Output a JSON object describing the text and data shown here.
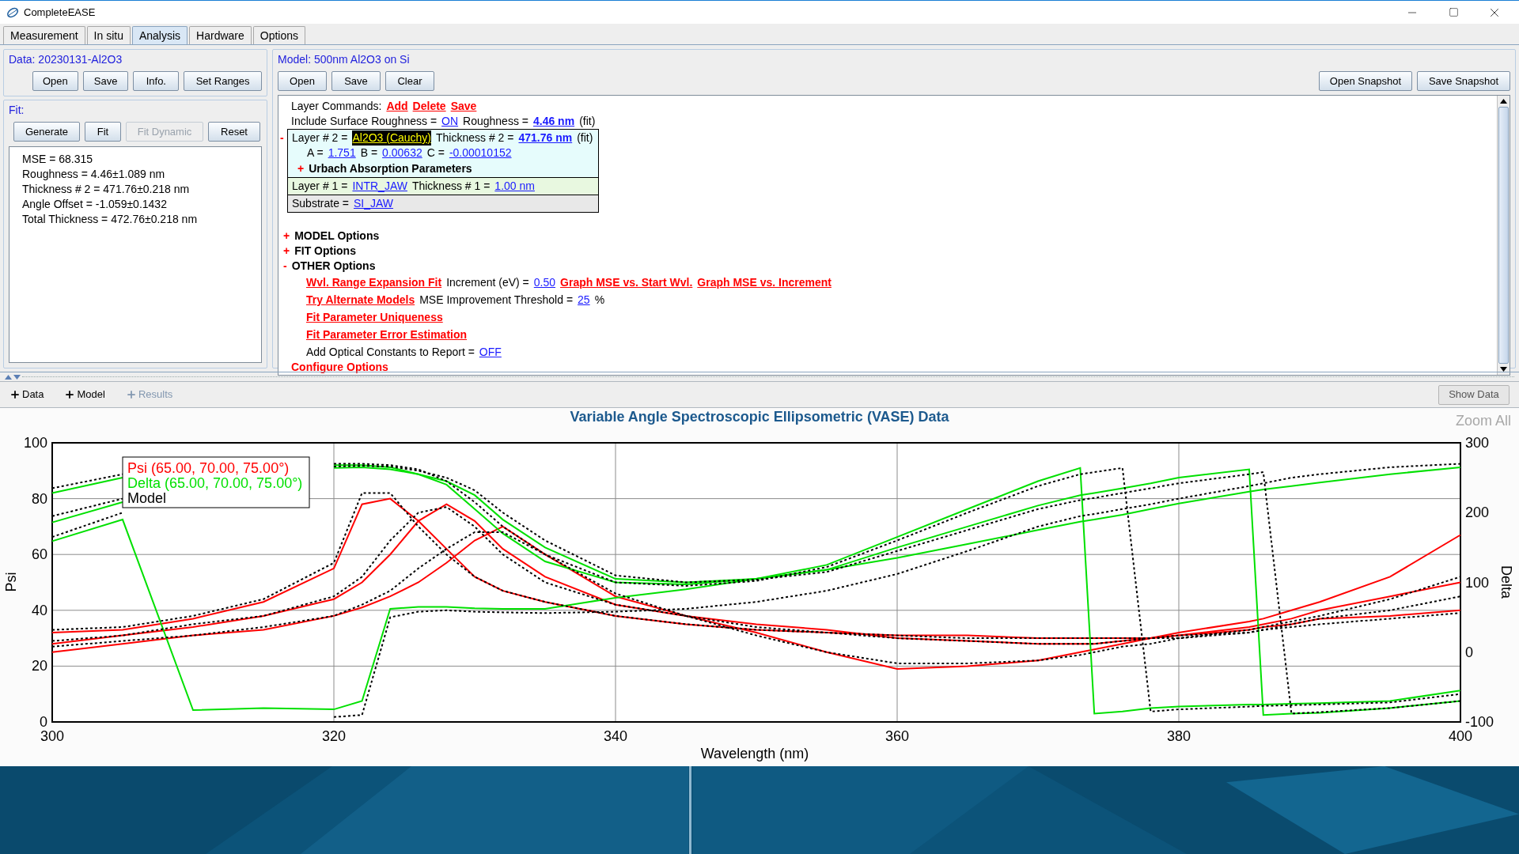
{
  "window": {
    "title": "CompleteEASE"
  },
  "tabs": [
    {
      "label": "Measurement",
      "selected": false
    },
    {
      "label": "In situ",
      "selected": false
    },
    {
      "label": "Analysis",
      "selected": true
    },
    {
      "label": "Hardware",
      "selected": false
    },
    {
      "label": "Options",
      "selected": false
    }
  ],
  "data_panel": {
    "title": "Data: 20230131-Al2O3",
    "buttons": [
      {
        "label": "Open",
        "disabled": false
      },
      {
        "label": "Save",
        "disabled": false
      },
      {
        "label": "Info.",
        "disabled": false
      },
      {
        "label": "Set Ranges",
        "disabled": false
      }
    ]
  },
  "fit_panel": {
    "title": "Fit:",
    "buttons": [
      {
        "label": "Generate",
        "disabled": false
      },
      {
        "label": "Fit",
        "disabled": false
      },
      {
        "label": "Fit Dynamic",
        "disabled": true
      },
      {
        "label": "Reset",
        "disabled": false
      }
    ],
    "results": [
      "MSE = 68.315",
      "Roughness = 4.46±1.089 nm",
      "Thickness # 2 = 471.76±0.218 nm",
      "Angle Offset = -1.059±0.1432",
      "Total Thickness = 472.76±0.218 nm"
    ]
  },
  "model_panel": {
    "title": "Model: 500nm Al2O3 on Si",
    "buttons": [
      {
        "label": "Open",
        "disabled": false
      },
      {
        "label": "Save",
        "disabled": false
      },
      {
        "label": "Clear",
        "disabled": false
      }
    ],
    "snapshot_buttons": [
      {
        "label": "Open Snapshot",
        "disabled": false
      },
      {
        "label": "Save Snapshot",
        "disabled": false
      }
    ],
    "content": [
      {
        "kind": "line",
        "segments": [
          {
            "kind": "text",
            "text": "Layer Commands:"
          },
          {
            "kind": "command",
            "text": "Add"
          },
          {
            "kind": "command",
            "text": "Delete"
          },
          {
            "kind": "command",
            "text": "Save"
          }
        ]
      },
      {
        "kind": "line",
        "segments": [
          {
            "kind": "text",
            "text": "Include Surface Roughness ="
          },
          {
            "kind": "link",
            "text": "ON"
          },
          {
            "kind": "text",
            "text": "Roughness ="
          },
          {
            "kind": "strong_link",
            "text": "4.46 nm"
          },
          {
            "kind": "text",
            "text": "(fit)"
          }
        ]
      },
      {
        "kind": "stack",
        "layers": [
          {
            "color": "#e6fcfc",
            "toggle": "-",
            "lines": [
              {
                "kind": "line",
                "segments": [
                  {
                    "kind": "text",
                    "text": "Layer # 2 ="
                  },
                  {
                    "kind": "selected_link",
                    "text": "Al2O3 (Cauchy)"
                  },
                  {
                    "kind": "text",
                    "text": "Thickness # 2 ="
                  },
                  {
                    "kind": "strong_link",
                    "text": "471.76 nm"
                  },
                  {
                    "kind": "text",
                    "text": "(fit)"
                  }
                ]
              },
              {
                "kind": "param",
                "segments": [
                  {
                    "kind": "text",
                    "text": "A ="
                  },
                  {
                    "kind": "link",
                    "text": "1.751"
                  },
                  {
                    "kind": "text",
                    "text": "B ="
                  },
                  {
                    "kind": "link",
                    "text": "0.00632"
                  },
                  {
                    "kind": "text",
                    "text": "C ="
                  },
                  {
                    "kind": "link",
                    "text": "-0.00010152"
                  }
                ]
              },
              {
                "kind": "sub",
                "segments": [
                  {
                    "kind": "toggle",
                    "text": "+"
                  },
                  {
                    "kind": "heading",
                    "text": "Urbach Absorption Parameters"
                  }
                ]
              }
            ]
          },
          {
            "color": "#e8f8e0",
            "lines": [
              {
                "kind": "line",
                "segments": [
                  {
                    "kind": "text",
                    "text": "Layer # 1 ="
                  },
                  {
                    "kind": "link",
                    "text": "INTR_JAW"
                  },
                  {
                    "kind": "text",
                    "text": "Thickness # 1 ="
                  },
                  {
                    "kind": "link",
                    "text": "1.00 nm"
                  }
                ]
              }
            ]
          },
          {
            "color": "#e8e8e8",
            "lines": [
              {
                "kind": "line",
                "segments": [
                  {
                    "kind": "text",
                    "text": "Substrate ="
                  },
                  {
                    "kind": "link",
                    "text": "SI_JAW"
                  }
                ]
              }
            ]
          }
        ]
      },
      {
        "kind": "section",
        "segments": [
          {
            "kind": "toggle",
            "text": "+"
          },
          {
            "kind": "heading",
            "text": "MODEL Options"
          }
        ]
      },
      {
        "kind": "section",
        "segments": [
          {
            "kind": "toggle",
            "text": "+"
          },
          {
            "kind": "heading",
            "text": "FIT Options"
          }
        ]
      },
      {
        "kind": "section",
        "segments": [
          {
            "kind": "toggle",
            "text": "-"
          },
          {
            "kind": "heading",
            "text": "OTHER Options"
          }
        ],
        "children": [
          {
            "kind": "line",
            "segments": [
              {
                "kind": "command",
                "text": "Wvl. Range Expansion Fit"
              },
              {
                "kind": "text",
                "text": "Increment (eV) ="
              },
              {
                "kind": "link",
                "text": "0.50"
              },
              {
                "kind": "command",
                "text": "Graph MSE vs. Start Wvl."
              },
              {
                "kind": "command",
                "text": "Graph MSE vs. Increment"
              }
            ]
          },
          {
            "kind": "line",
            "segments": [
              {
                "kind": "command",
                "text": "Try Alternate Models"
              },
              {
                "kind": "text",
                "text": "MSE Improvement Threshold ="
              },
              {
                "kind": "link",
                "text": "25"
              },
              {
                "kind": "text",
                "text": "%"
              }
            ]
          },
          {
            "kind": "line",
            "segments": [
              {
                "kind": "command",
                "text": "Fit Parameter Uniqueness"
              }
            ]
          },
          {
            "kind": "line",
            "segments": [
              {
                "kind": "command",
                "text": "Fit Parameter Error Estimation"
              }
            ]
          },
          {
            "kind": "line",
            "segments": [
              {
                "kind": "text",
                "text": "Add Optical Constants to Report ="
              },
              {
                "kind": "link",
                "text": "OFF"
              }
            ]
          }
        ]
      },
      {
        "kind": "line",
        "segments": [
          {
            "kind": "command",
            "text": "Configure Options"
          }
        ]
      }
    ]
  },
  "chart_toolbar": {
    "buttons": [
      {
        "label": "Data",
        "disabled": false
      },
      {
        "label": "Model",
        "disabled": false
      },
      {
        "label": "Results",
        "disabled": true
      }
    ],
    "show_data": {
      "label": "Show Data"
    }
  },
  "chart": {
    "zoom_all": "Zoom All",
    "chart_data": {
      "type": "line",
      "title": "Variable Angle Spectroscopic Ellipsometric (VASE) Data",
      "xlabel": "Wavelength (nm)",
      "ylabel": "Psi",
      "y2label": "Delta",
      "x": [
        300,
        305,
        310,
        315,
        320,
        322,
        324,
        326,
        328,
        330,
        332,
        335,
        340,
        345,
        350,
        355,
        360,
        365,
        370,
        373,
        374,
        376,
        378,
        380,
        385,
        386,
        388,
        390,
        395,
        400
      ],
      "grid": true,
      "xlim": [
        300,
        400
      ],
      "ylim": [
        0,
        100
      ],
      "y2lim": [
        -100,
        300
      ],
      "xticks": [
        300,
        320,
        340,
        360,
        380,
        400
      ],
      "yticks": [
        0,
        20,
        40,
        60,
        80,
        100
      ],
      "y2ticks": [
        -100,
        0,
        100,
        200,
        300
      ],
      "series": [
        {
          "name": "Psi (65.00, 70.00, 75.00°)",
          "color": "#ff0000",
          "values": [
            32,
            33,
            37,
            43,
            55,
            78,
            80,
            72,
            62,
            52,
            47,
            43,
            38,
            35,
            33,
            32,
            31,
            31,
            30,
            30,
            30,
            30,
            30,
            31,
            33,
            34,
            35,
            37,
            38,
            40
          ]
        },
        {
          "color": "#ff0000",
          "values": [
            28,
            31,
            34,
            38,
            44,
            50,
            60,
            72,
            78,
            72,
            62,
            52,
            42,
            38,
            35,
            33,
            30,
            29,
            28,
            28,
            28,
            29,
            30,
            31,
            34,
            35,
            37,
            40,
            45,
            50
          ]
        },
        {
          "color": "#ff0000",
          "values": [
            25,
            28,
            31,
            33,
            38,
            41,
            45,
            50,
            57,
            65,
            70,
            60,
            45,
            38,
            32,
            25,
            19,
            20,
            22,
            25,
            26,
            28,
            30,
            32,
            36,
            37,
            40,
            43,
            52,
            67
          ]
        },
        {
          "name": "Delta (65.00, 70.00, 75.00°)",
          "color": "#00e000",
          "axis": "y2",
          "values": [
            228,
            250,
            null,
            null,
            268,
            268,
            265,
            255,
            240,
            205,
            170,
            130,
            100,
            97,
            105,
            125,
            165,
            205,
            245,
            264,
            -88,
            -85,
            -80,
            -78,
            -75,
            -75,
            -74,
            -73,
            -70,
            -55
          ]
        },
        {
          "color": "#00e000",
          "axis": "y2",
          "values": [
            186,
            215,
            null,
            null,
            264,
            265,
            262,
            255,
            245,
            225,
            190,
            150,
            105,
            100,
            105,
            118,
            150,
            180,
            210,
            225,
            228,
            235,
            242,
            250,
            262,
            -90,
            -88,
            -87,
            -80,
            -70
          ]
        },
        {
          "color": "#00e000",
          "axis": "y2",
          "values": [
            159,
            190,
            -83,
            -80,
            -82,
            -70,
            62,
            65,
            65,
            63,
            62,
            62,
            78,
            90,
            105,
            118,
            135,
            155,
            175,
            187,
            190,
            197,
            205,
            213,
            230,
            233,
            238,
            243,
            255,
            265
          ]
        },
        {
          "name": "Model",
          "color": "#000000",
          "line_style": "dotted",
          "values": [
            33,
            34,
            38,
            44,
            57,
            82,
            82,
            70,
            60,
            52,
            47,
            43,
            38,
            35,
            33,
            32,
            31,
            30,
            30,
            30,
            30,
            30,
            30,
            31,
            32,
            33,
            34,
            35,
            37,
            39
          ]
        },
        {
          "color": "#000000",
          "line_style": "dotted",
          "values": [
            29,
            31,
            35,
            38,
            45,
            52,
            65,
            75,
            77,
            70,
            60,
            50,
            42,
            38,
            34,
            32,
            30,
            29,
            28,
            28,
            28,
            29,
            30,
            30,
            32,
            33,
            35,
            37,
            40,
            45
          ]
        },
        {
          "color": "#000000",
          "line_style": "dotted",
          "values": [
            27,
            29,
            31,
            34,
            38,
            42,
            47,
            55,
            62,
            68,
            68,
            60,
            46,
            38,
            31,
            25,
            21,
            21,
            22,
            24,
            25,
            27,
            28,
            30,
            33,
            34,
            36,
            38,
            44,
            52
          ]
        },
        {
          "color": "#000000",
          "line_style": "dotted",
          "axis": "y2",
          "values": [
            235,
            255,
            null,
            null,
            270,
            270,
            268,
            262,
            245,
            215,
            180,
            140,
            100,
            95,
            102,
            122,
            160,
            200,
            238,
            255,
            258,
            264,
            -85,
            -82,
            -78,
            -77,
            -76,
            -75,
            -72,
            -60
          ]
        },
        {
          "color": "#000000",
          "line_style": "dotted",
          "axis": "y2",
          "values": [
            195,
            220,
            null,
            null,
            266,
            267,
            266,
            260,
            250,
            232,
            200,
            160,
            110,
            100,
            104,
            115,
            145,
            175,
            205,
            218,
            221,
            228,
            235,
            242,
            255,
            258,
            -88,
            -86,
            -80,
            -70
          ]
        },
        {
          "color": "#000000",
          "line_style": "dotted",
          "axis": "y2",
          "values": [
            165,
            200,
            null,
            null,
            -93,
            -90,
            50,
            58,
            60,
            58,
            57,
            56,
            58,
            62,
            72,
            88,
            112,
            145,
            180,
            195,
            198,
            205,
            212,
            220,
            238,
            242,
            250,
            255,
            265,
            270
          ]
        }
      ]
    }
  }
}
